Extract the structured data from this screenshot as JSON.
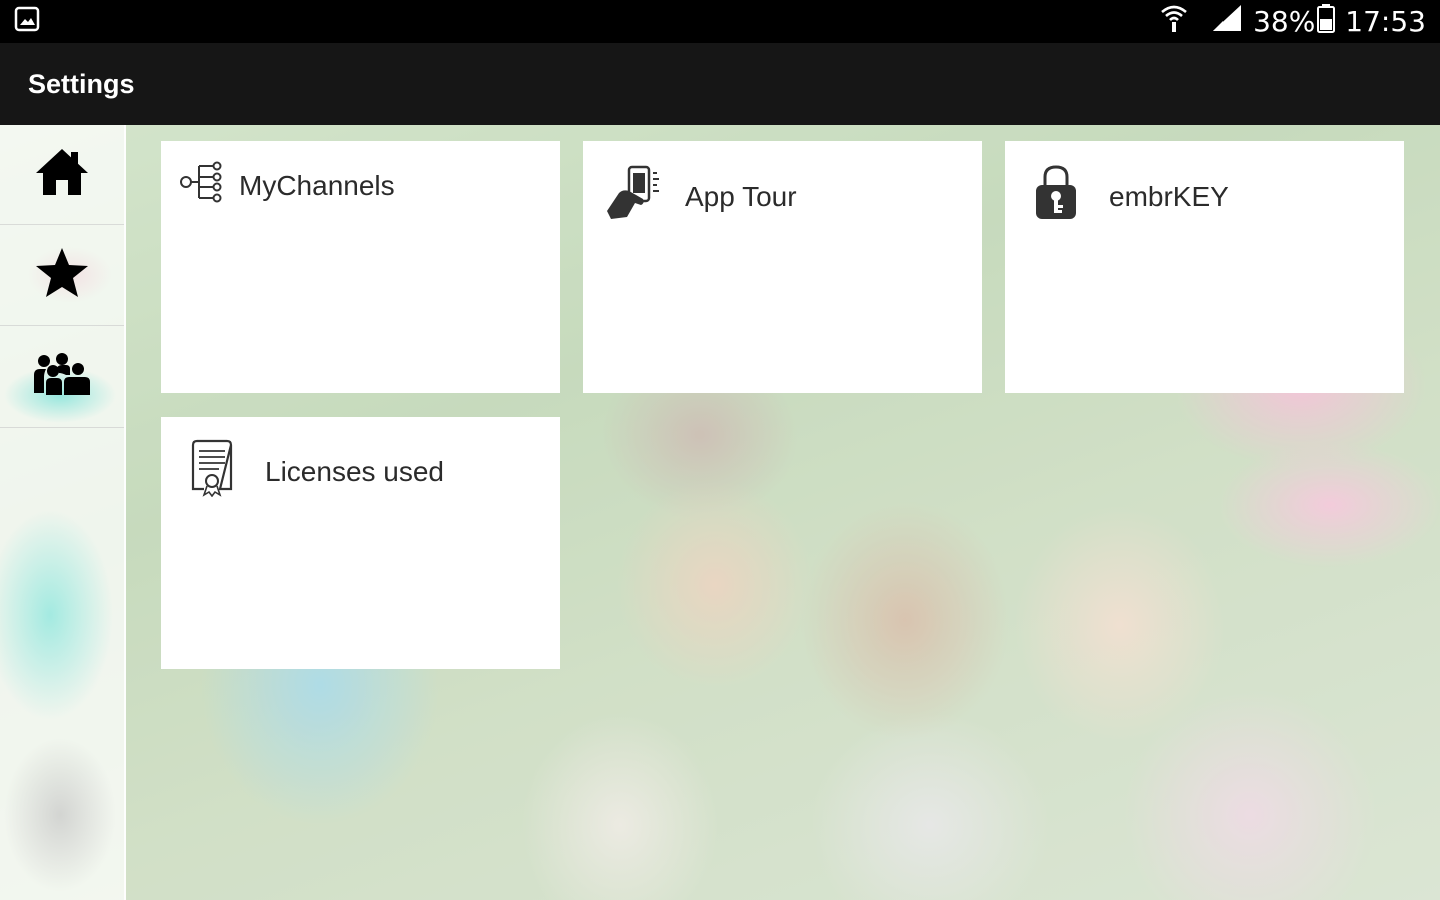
{
  "status_bar": {
    "battery_percent": "38%",
    "time": "17:53",
    "icons": [
      "gallery-notification-icon",
      "wifi-icon",
      "cellular-signal-icon",
      "battery-icon"
    ]
  },
  "app_bar": {
    "title": "Settings"
  },
  "sidebar": {
    "items": [
      {
        "icon": "home-icon"
      },
      {
        "icon": "star-icon"
      },
      {
        "icon": "group-icon"
      }
    ]
  },
  "tiles": [
    {
      "label": "MyChannels",
      "icon": "channels-icon"
    },
    {
      "label": "App Tour",
      "icon": "app-tour-icon"
    },
    {
      "label": "embrKEY",
      "icon": "key-lock-icon"
    },
    {
      "label": "Licenses used",
      "icon": "license-certificate-icon"
    }
  ],
  "colors": {
    "status_bar_bg": "#000000",
    "app_bar_bg": "#161616",
    "tile_bg": "#ffffff",
    "text_dark": "#2b2b2b"
  }
}
